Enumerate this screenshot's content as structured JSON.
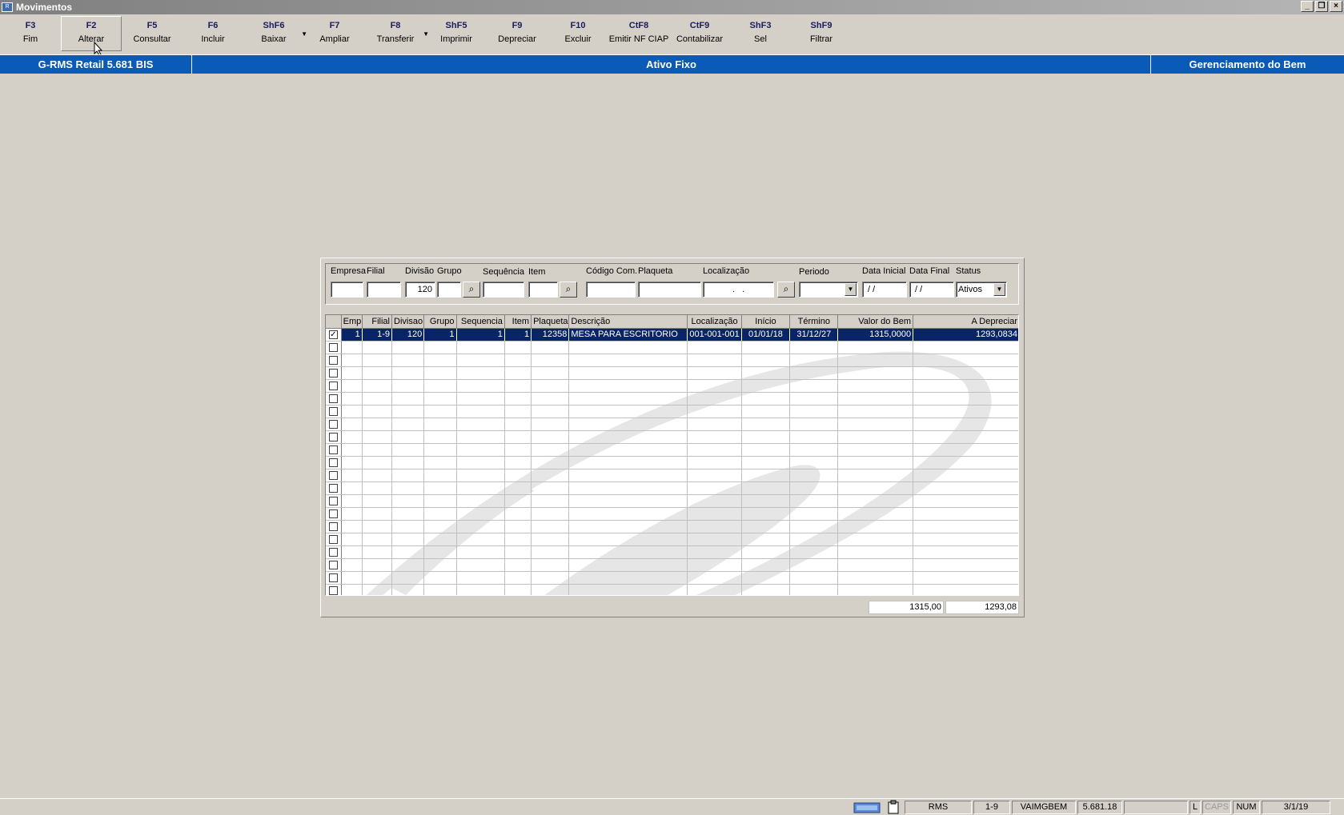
{
  "window": {
    "title": "Movimentos"
  },
  "toolbar": [
    {
      "key": "F3",
      "label": "Fim"
    },
    {
      "key": "F2",
      "label": "Alterar"
    },
    {
      "key": "F5",
      "label": "Consultar"
    },
    {
      "key": "F6",
      "label": "Incluir"
    },
    {
      "key": "ShF6",
      "label": "Baixar"
    },
    {
      "key": "F7",
      "label": "Ampliar"
    },
    {
      "key": "F8",
      "label": "Transferir"
    },
    {
      "key": "ShF5",
      "label": "Imprimir"
    },
    {
      "key": "F9",
      "label": "Depreciar"
    },
    {
      "key": "F10",
      "label": "Excluir"
    },
    {
      "key": "CtF8",
      "label": "Emitir NF CIAP"
    },
    {
      "key": "CtF9",
      "label": "Contabilizar"
    },
    {
      "key": "ShF3",
      "label": "Sel"
    },
    {
      "key": "ShF9",
      "label": "Filtrar"
    }
  ],
  "header": {
    "app": "G-RMS Retail 5.681 BIS",
    "module": "Ativo Fixo",
    "screen": "Gerenciamento do Bem"
  },
  "filters": {
    "empresa_label": "Empresa",
    "filial_label": "Filial",
    "divisao_label": "Divisão",
    "divisao_value": "120",
    "grupo_label": "Grupo",
    "sequencia_label": "Sequência",
    "item_label": "Item",
    "codigo_label": "Código Com.",
    "plaqueta_label": "Plaqueta",
    "localizacao_label": "Localização",
    "localizacao_value": "  .   .  ",
    "periodo_label": "Periodo",
    "data_inicial_label": "Data Inicial",
    "data_inicial_value": " / /",
    "data_final_label": "Data Final",
    "data_final_value": " / /",
    "status_label": "Status",
    "status_value": "Ativos"
  },
  "grid": {
    "columns": [
      "Emp",
      "Filial",
      "Divisao",
      "Grupo",
      "Sequencia",
      "Item",
      "Plaqueta",
      "Descrição",
      "Localização",
      "Início",
      "Término",
      "Valor do Bem",
      "A Depreciar"
    ],
    "rows": [
      {
        "checked": true,
        "emp": "1",
        "filial": "1-9",
        "divisao": "120",
        "grupo": "1",
        "sequencia": "1",
        "item": "1",
        "plaqueta": "12358",
        "descricao": "MESA PARA ESCRITORIO",
        "localizacao": "001-001-001",
        "inicio": "01/01/18",
        "termino": "31/12/27",
        "valor": "1315,0000",
        "depreciar": "1293,0834"
      }
    ],
    "empty_rows": 20
  },
  "totals": {
    "valor": "1315,00",
    "depreciar": "1293,08"
  },
  "statusbar": {
    "system": "RMS",
    "filial": "1-9",
    "user": "VAIMGBEM",
    "version": "5.681.18",
    "blank": "",
    "l": "L",
    "caps": "CAPS",
    "num": "NUM",
    "date": "3/1/19"
  }
}
